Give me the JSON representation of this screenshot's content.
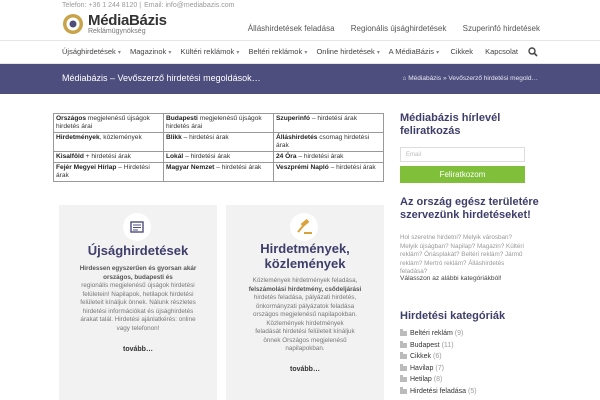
{
  "topbar": {
    "phone": "Telefon: +36 1 244 8120 |",
    "email": "Email: info@mediabazis.com",
    "logo_name": "MédiaBázis",
    "logo_sub": "Reklámügynökség",
    "links": [
      "Álláshirdetések feladása",
      "Regionális újsághirdetések",
      "Szuperinfó hirdetések"
    ]
  },
  "nav": {
    "items": [
      "Újsághirdetések",
      "Magazinok",
      "Kültéri reklámok",
      "Beltéri reklámok",
      "Online hirdetések",
      "A MédiaBázis"
    ],
    "right": [
      "Cikkek",
      "Kapcsolat"
    ]
  },
  "titlebar": {
    "title": "Médiabázis – Vevőszerző hirdetési megoldások…",
    "breadcrumb_home": "Médiabázis",
    "breadcrumb_current": "Vevőszerző hirdetési megold…"
  },
  "table": [
    [
      {
        "b": "Országos",
        "t": " megjelenésű újságok hirdetés árai"
      },
      {
        "b": "Budapesti",
        "t": " megjelenésű újságok hirdetés árai"
      },
      {
        "b": "Szuperinfó",
        "t": " – hirdetési árak"
      }
    ],
    [
      {
        "b": "Hirdetmények",
        "t": ", közlemények"
      },
      {
        "b": "Blikk",
        "t": " – hirdetési árak"
      },
      {
        "b": "Álláshirdetés",
        "t": " csomag hirdetési árak"
      }
    ],
    [
      {
        "b": "Kisalföld",
        "t": " + hirdetési árak"
      },
      {
        "b": "Lokál",
        "t": " – hirdetési árak"
      },
      {
        "b": "24 Óra",
        "t": " – hirdetési árak"
      }
    ],
    [
      {
        "b": "Fejér Megyei Hírlap",
        "t": " – Hirdetési árak"
      },
      {
        "b": "Magyar Nemzet",
        "t": " – hirdetési árak"
      },
      {
        "b": "Veszprémi Napló",
        "t": " – hirdetési árak"
      }
    ]
  ],
  "card1": {
    "title": "Újsághirdetések",
    "l1": "Hirdessen egyszerűen és gyorsan akár",
    "l2": "országos, budapesti és",
    "l3": "regionális megjelenésű újságok hirdetési",
    "l4": "felületein! Napilapok, hetilapok hirdetési",
    "l5": "felületeit kínáljuk önnek. Nálunk részletes",
    "l6": "hirdetési információkat és újsághirdetés",
    "l7": "árakat talál. Hirdetési ajánlatkérés: online",
    "l8": "vagy telefonon!",
    "more": "tovább…"
  },
  "card2": {
    "title1": "Hirdetmények,",
    "title2": "közlemények",
    "l1": "Közlemények hirdetmények feladása,",
    "l2": "felszámolási hirdetmény, csődeljárási",
    "l3": "hirdetés feladása, pályázati hirdetés,",
    "l4": "önkormányzati pályázatok feladása",
    "l5": "országos megjelenésű napilapokban.",
    "l6": "Közlemények hirdetmények",
    "l7": "feladását hirdetési felületeit kínáljuk",
    "l8": "önnek Országos megjelenésű",
    "l9": "napilapokban.",
    "more": "tovább…"
  },
  "sidebar": {
    "newsletter_title": "Médiabázis hírlevél feliratkozás",
    "email_placeholder": "Email",
    "subscribe": "Feliratkozom",
    "campaign_title": "Az ország egész területére szervezünk hirdetéseket!",
    "campaign_text": "Hol szeretne hirdetni? Melyik városban? Melyik újságban? Napilap? Magazin? Kültéri reklám? Óriásplakát? Beltéri reklám? Jármű reklám? Mertró reklám? Álláshirdetés feladása?",
    "select_text": "Válasszon az alábbi kategóriákból!",
    "categories_title": "Hirdetési kategóriák",
    "categories": [
      {
        "name": "Beltéri reklám",
        "count": "(9)"
      },
      {
        "name": "Budapest",
        "count": "(11)"
      },
      {
        "name": "Cikkek",
        "count": "(6)"
      },
      {
        "name": "Havilap",
        "count": "(7)"
      },
      {
        "name": "Hetilap",
        "count": "(8)"
      },
      {
        "name": "Hirdetési feladása",
        "count": "(5)"
      }
    ]
  },
  "colors": {
    "accent": "#4e4e7e",
    "button": "#7fbf3a",
    "card_bg": "#f2f2f2"
  }
}
